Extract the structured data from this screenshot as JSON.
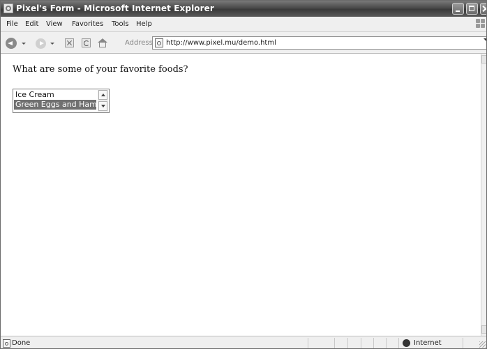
{
  "window": {
    "title": "Pixel's Form - Microsoft Internet Explorer"
  },
  "menu": {
    "items": [
      "File",
      "Edit",
      "View",
      "Favorites",
      "Tools",
      "Help"
    ]
  },
  "toolbar": {
    "address_label": "Address",
    "address_value": "http://www.pixel.mu/demo.html"
  },
  "page": {
    "question": "What are some of your favorite foods?",
    "listbox": {
      "options": [
        "Ice Cream",
        "Green Eggs and Ham"
      ],
      "selected": "Green Eggs and Ham"
    }
  },
  "status": {
    "text": "Done",
    "zone": "Internet"
  },
  "colors": {
    "selection": "#707070",
    "titlebar": "#4a4a4a"
  }
}
